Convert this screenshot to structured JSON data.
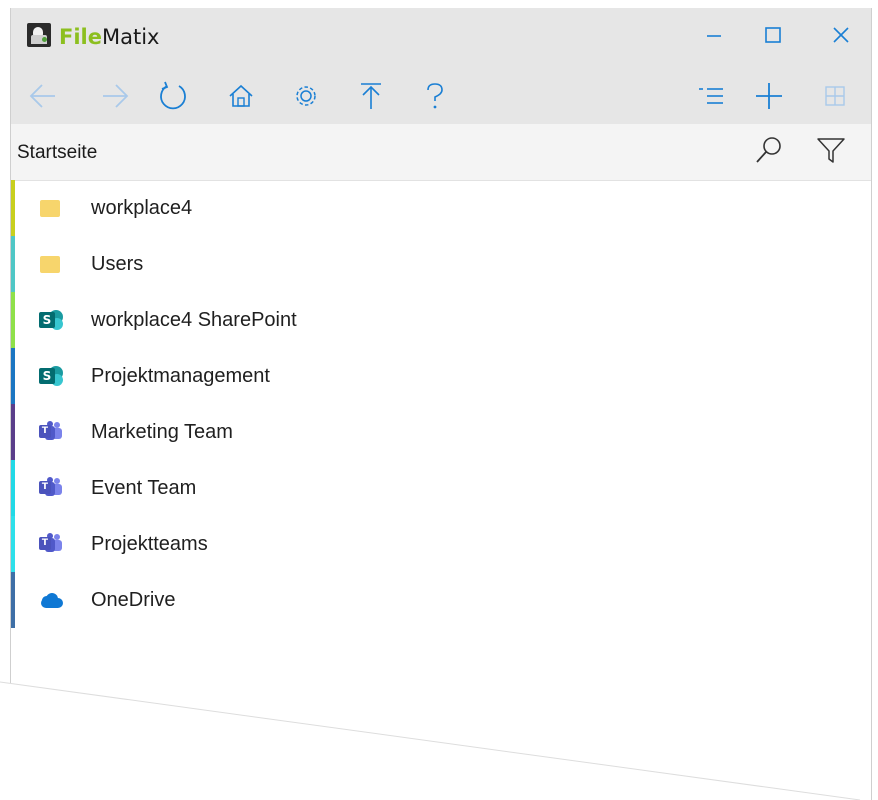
{
  "app": {
    "name_part1": "File",
    "name_part2": "Matix",
    "accent": "#8cbf1f"
  },
  "window_controls": {
    "minimize_icon": "minimize-icon",
    "maximize_icon": "maximize-icon",
    "close_icon": "close-icon"
  },
  "toolbar": {
    "left_icons": [
      "back-arrow-icon",
      "forward-arrow-icon",
      "refresh-icon",
      "home-icon",
      "settings-gear-icon",
      "move-to-top-icon",
      "help-question-icon"
    ],
    "right_icons": [
      "sort-list-icon",
      "add-plus-icon",
      "grid-view-icon"
    ],
    "icon_color": "#1a7fd4"
  },
  "breadcrumb": {
    "label": "Startseite",
    "search_icon": "search-icon",
    "filter_icon": "filter-icon"
  },
  "items": [
    {
      "label": "workplace4",
      "icon": "folder-icon",
      "bar_color": "#c8cf1e"
    },
    {
      "label": "Users",
      "icon": "folder-icon",
      "bar_color": "#4fc7c6"
    },
    {
      "label": "workplace4 SharePoint",
      "icon": "sharepoint-icon",
      "bar_color": "#8fe04a"
    },
    {
      "label": "Projektmanagement",
      "icon": "sharepoint-icon",
      "bar_color": "#1b76c2"
    },
    {
      "label": "Marketing Team",
      "icon": "teams-icon",
      "bar_color": "#5a3e8a"
    },
    {
      "label": "Event Team",
      "icon": "teams-icon",
      "bar_color": "#22d9e6"
    },
    {
      "label": "Projektteams",
      "icon": "teams-icon",
      "bar_color": "#2ee0ea"
    },
    {
      "label": "OneDrive",
      "icon": "onedrive-icon",
      "bar_color": "#3e6fa6"
    }
  ]
}
